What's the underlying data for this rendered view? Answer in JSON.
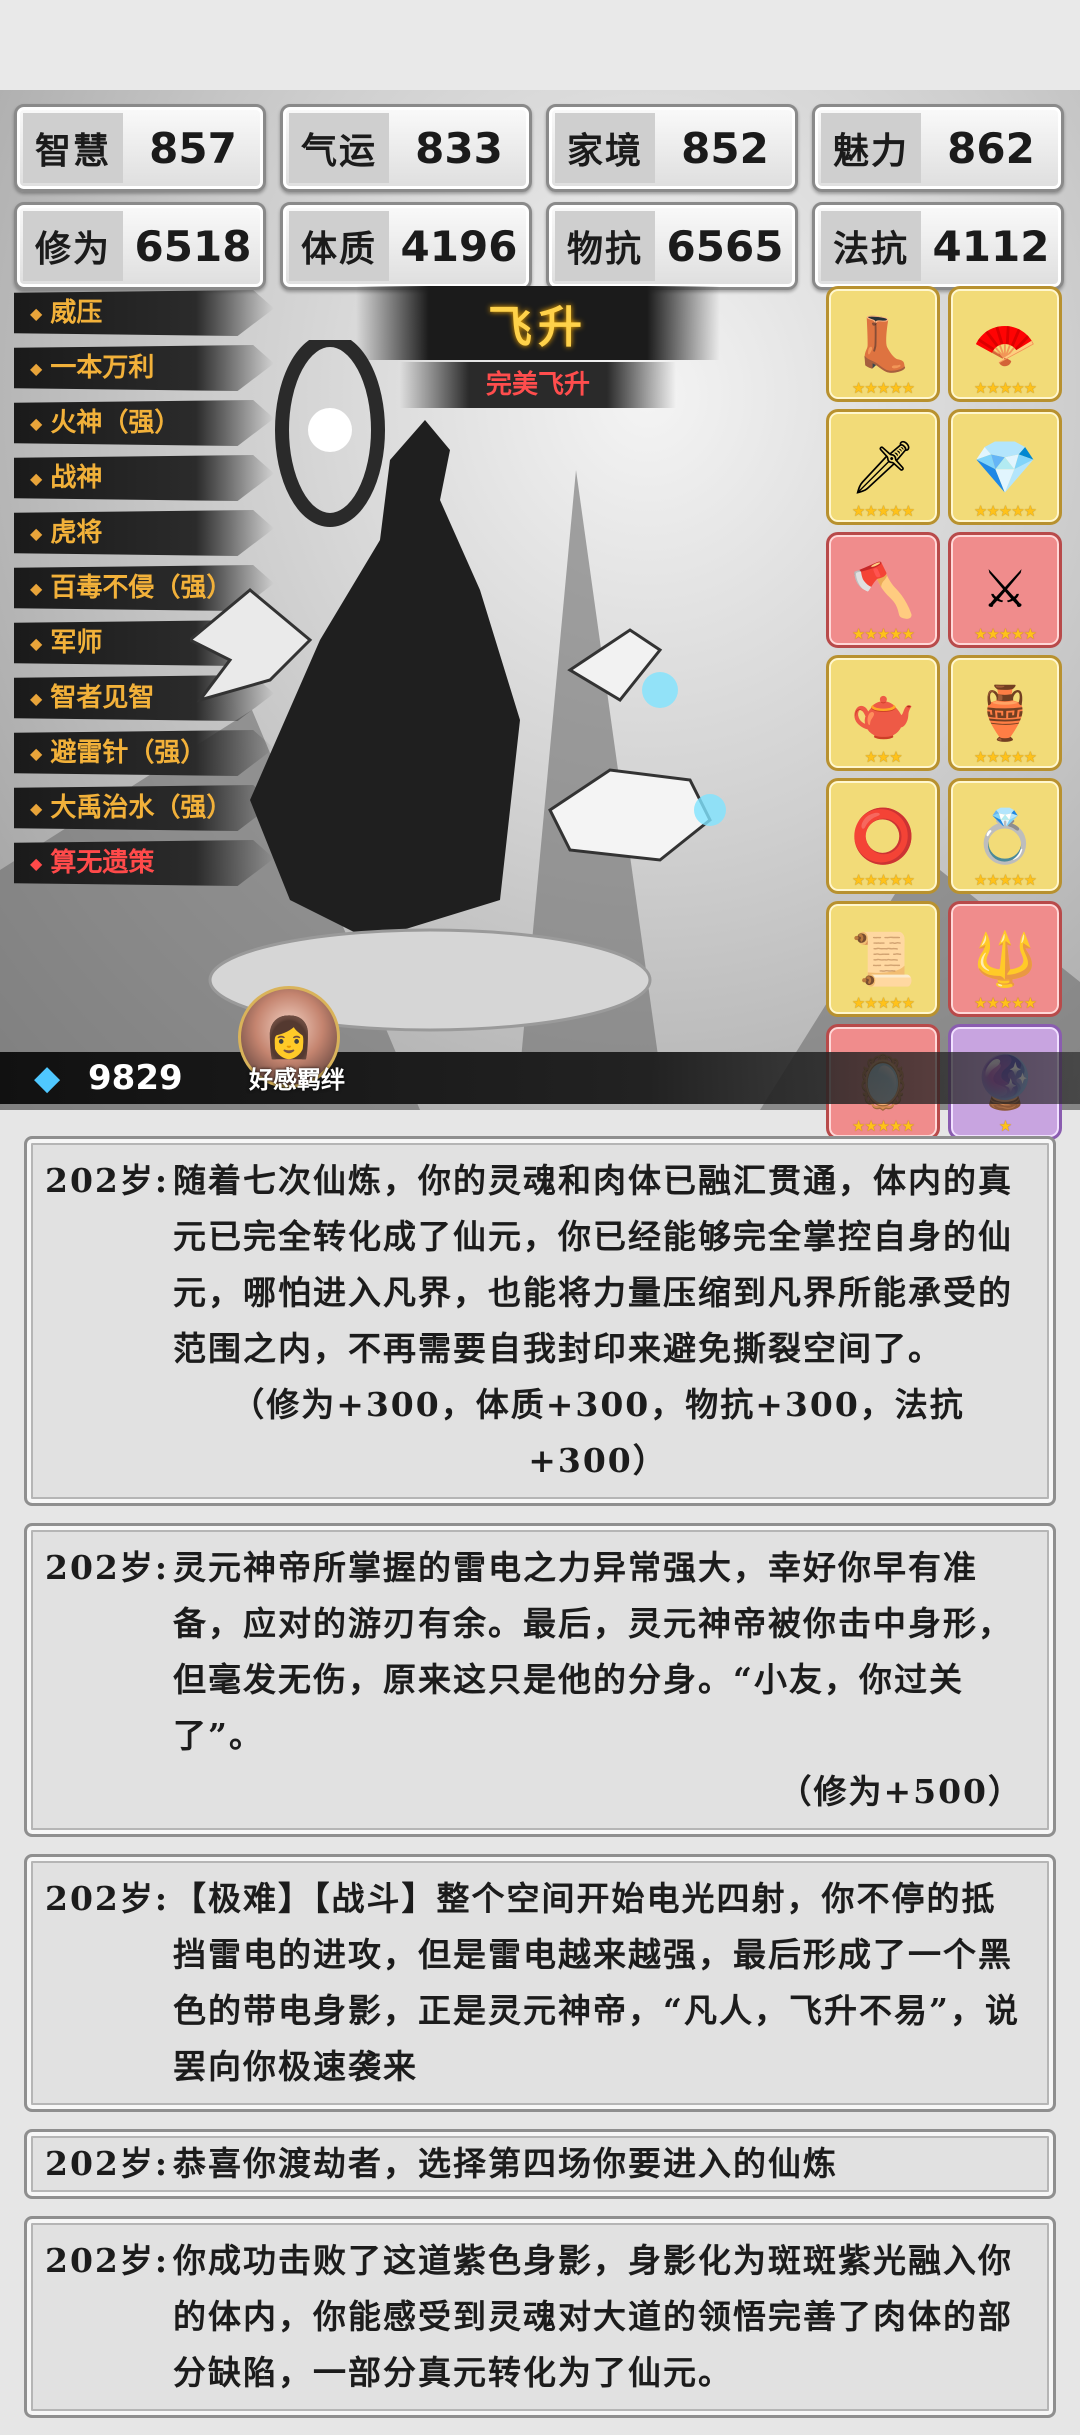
{
  "stats": [
    {
      "label": "智慧",
      "value": "857"
    },
    {
      "label": "气运",
      "value": "833"
    },
    {
      "label": "家境",
      "value": "852"
    },
    {
      "label": "魅力",
      "value": "862"
    },
    {
      "label": "修为",
      "value": "6518"
    },
    {
      "label": "体质",
      "value": "4196"
    },
    {
      "label": "物抗",
      "value": "6565"
    },
    {
      "label": "法抗",
      "value": "4112"
    }
  ],
  "skills": [
    {
      "label": "威压"
    },
    {
      "label": "一本万利"
    },
    {
      "label": "火神（强）"
    },
    {
      "label": "战神"
    },
    {
      "label": "虎将"
    },
    {
      "label": "百毒不侵（强）"
    },
    {
      "label": "军师"
    },
    {
      "label": "智者见智"
    },
    {
      "label": "避雷针（强）"
    },
    {
      "label": "大禹治水（强）"
    },
    {
      "label": "算无遗策"
    }
  ],
  "title": "飞升",
  "subtitle": "完美飞升",
  "items": [
    {
      "icon": "boots-icon",
      "glyph": "👢",
      "rarity": "gold",
      "stars": "★★★★★"
    },
    {
      "icon": "fan-icon",
      "glyph": "🪭",
      "rarity": "gold",
      "stars": "★★★★★"
    },
    {
      "icon": "dagger-icon",
      "glyph": "🗡",
      "rarity": "gold",
      "stars": "★★★★★"
    },
    {
      "icon": "crystal-icon",
      "glyph": "💎",
      "rarity": "gold",
      "stars": "★★★★★"
    },
    {
      "icon": "halberd-icon",
      "glyph": "🪓",
      "rarity": "red",
      "stars": "★★★★★"
    },
    {
      "icon": "sword-icon",
      "glyph": "⚔",
      "rarity": "red",
      "stars": "★★★★★"
    },
    {
      "icon": "teapot-icon",
      "glyph": "🫖",
      "rarity": "gold",
      "stars": "★★★"
    },
    {
      "icon": "gourd-icon",
      "glyph": "🏺",
      "rarity": "gold",
      "stars": "★★★★★"
    },
    {
      "icon": "bracelet-icon",
      "glyph": "⭕",
      "rarity": "gold",
      "stars": "★★★★★"
    },
    {
      "icon": "ring-icon",
      "glyph": "💍",
      "rarity": "gold",
      "stars": "★★★★★"
    },
    {
      "icon": "scroll-icon",
      "glyph": "📜",
      "rarity": "gold",
      "stars": "★★★★★"
    },
    {
      "icon": "spear-icon",
      "glyph": "🔱",
      "rarity": "red",
      "stars": "★★★★★"
    },
    {
      "icon": "mirror-icon",
      "glyph": "🪞",
      "rarity": "red",
      "stars": "★★★★★"
    },
    {
      "icon": "orb-icon",
      "glyph": "🔮",
      "rarity": "purple",
      "stars": "★"
    }
  ],
  "gems": "9829",
  "favor_label": "好感羁绊",
  "log": [
    {
      "age": "202岁:",
      "text": "随着七次仙炼，你的灵魂和肉体已融汇贯通，体内的真元已完全转化成了仙元，你已经能够完全掌控自身的仙元，哪怕进入凡界，也能将力量压缩到凡界所能承受的范围之内，不再需要自我封印来避免撕裂空间了。",
      "note": "（修为+300，体质+300，物抗+300，法抗+300）"
    },
    {
      "age": "202岁:",
      "text": "灵元神帝所掌握的雷电之力异常强大，幸好你早有准备，应对的游刃有余。最后，灵元神帝被你击中身形，但毫发无伤，原来这只是他的分身。“小友，你过关了”。",
      "note": "（修为+500）"
    },
    {
      "age": "202岁:",
      "text": "【极难】【战斗】整个空间开始电光四射，你不停的抵挡雷电的进攻，但是雷电越来越强，最后形成了一个黑色的带电身影，正是灵元神帝，“凡人，飞升不易”，说罢向你极速袭来",
      "note": ""
    },
    {
      "age": "202岁:",
      "text": "恭喜你渡劫者，选择第四场你要进入的仙炼",
      "note": ""
    },
    {
      "age": "202岁:",
      "text": "你成功击败了这道紫色身影，身影化为斑斑紫光融入你的体内，你能感受到灵魂对大道的领悟完善了肉体的部分缺陷，一部分真元转化为了仙元。",
      "note": ""
    }
  ]
}
